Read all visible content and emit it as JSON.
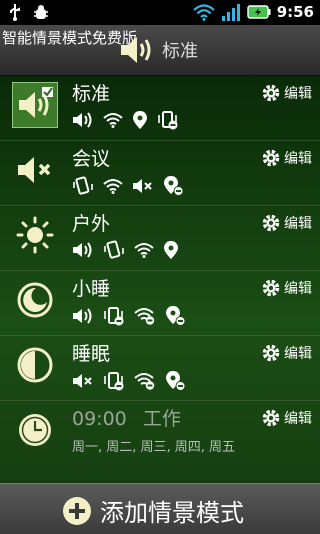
{
  "status_bar": {
    "time": "9:56",
    "icons": [
      "usb-icon",
      "debug-icon",
      "wifi-icon",
      "signal-icon",
      "battery-icon"
    ]
  },
  "header": {
    "app_title": "智能情景模式免费版",
    "current_mode": "标准"
  },
  "profiles": [
    {
      "name": "标准",
      "icon": "speaker-on-icon",
      "selected": true,
      "edit_label": "编辑",
      "status_icons": [
        "volume-on-icon",
        "wifi-icon",
        "location-icon",
        "vibrate-off-icon"
      ]
    },
    {
      "name": "会议",
      "icon": "speaker-mute-icon",
      "selected": false,
      "edit_label": "编辑",
      "status_icons": [
        "vibrate-icon",
        "wifi-icon",
        "volume-mute-icon",
        "location-off-icon"
      ]
    },
    {
      "name": "户外",
      "icon": "sun-icon",
      "selected": false,
      "edit_label": "编辑",
      "status_icons": [
        "volume-on-icon",
        "vibrate-icon",
        "wifi-icon",
        "location-icon"
      ]
    },
    {
      "name": "小睡",
      "icon": "moon-icon",
      "selected": false,
      "edit_label": "编辑",
      "status_icons": [
        "volume-on-icon",
        "vibrate-off-icon",
        "wifi-off-icon",
        "location-off-icon"
      ]
    },
    {
      "name": "睡眠",
      "icon": "half-moon-icon",
      "selected": false,
      "edit_label": "编辑",
      "status_icons": [
        "volume-mute-icon",
        "vibrate-off-icon",
        "wifi-off-icon",
        "location-off-icon"
      ]
    }
  ],
  "timer": {
    "time": "09:00",
    "profile": "工作",
    "days": "周一, 周二, 周三, 周四, 周五",
    "edit_label": "编辑"
  },
  "footer": {
    "add_label": "添加情景模式"
  },
  "colors": {
    "accent_green": "#3d7a2a",
    "icon_cream": "#f3f0c8"
  }
}
